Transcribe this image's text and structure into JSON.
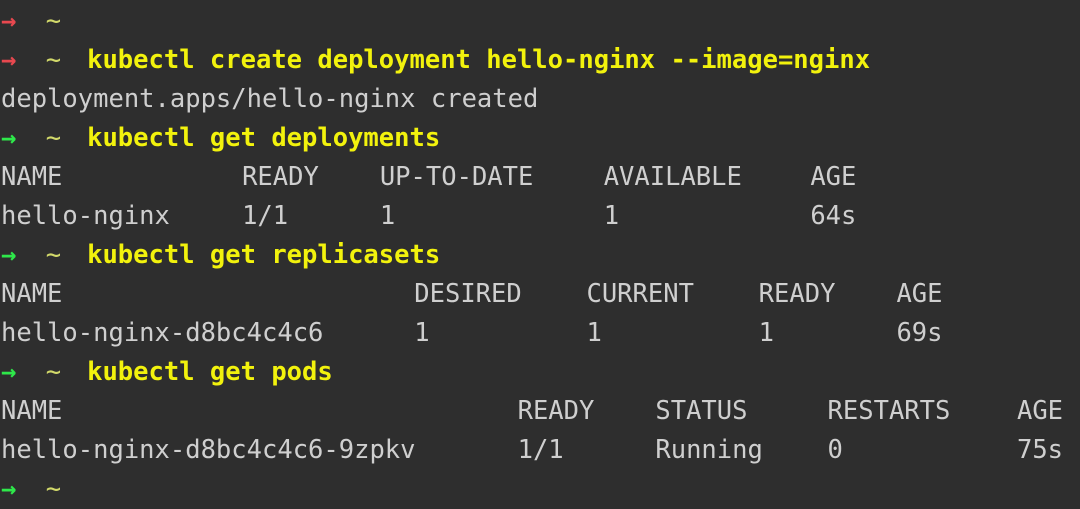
{
  "terminal": {
    "background_color": "#2e2e2e",
    "prompt_symbol": "→",
    "cwd_symbol": "~",
    "colors": {
      "prompt_error": "#e8484f",
      "prompt_ok": "#2ee84a",
      "cwd": "#d2d96a",
      "command": "#f2f20d",
      "output": "#cfcfcf"
    },
    "lines": [
      {
        "kind": "prompt",
        "prompt_color": "prompt_error",
        "arrow": "→",
        "cwd": "~",
        "command": ""
      },
      {
        "kind": "prompt",
        "prompt_color": "prompt_error",
        "arrow": "→",
        "cwd": "~",
        "command": "kubectl create deployment hello-nginx --image=nginx"
      },
      {
        "kind": "output",
        "text": "deployment.apps/hello-nginx created"
      },
      {
        "kind": "prompt",
        "prompt_color": "prompt_ok",
        "arrow": "→",
        "cwd": "~",
        "command": "kubectl get deployments"
      },
      {
        "kind": "table-header",
        "table": "deployments",
        "cells": [
          {
            "text": "NAME",
            "col": 0
          },
          {
            "text": "READY",
            "col": 14
          },
          {
            "text": "UP-TO-DATE",
            "col": 22
          },
          {
            "text": "AVAILABLE",
            "col": 35
          },
          {
            "text": "AGE",
            "col": 47
          }
        ]
      },
      {
        "kind": "table-row",
        "table": "deployments",
        "cells": [
          {
            "text": "hello-nginx",
            "col": 0
          },
          {
            "text": "1/1",
            "col": 14
          },
          {
            "text": "1",
            "col": 22
          },
          {
            "text": "1",
            "col": 35
          },
          {
            "text": "64s",
            "col": 47
          }
        ]
      },
      {
        "kind": "prompt",
        "prompt_color": "prompt_ok",
        "arrow": "→",
        "cwd": "~",
        "command": "kubectl get replicasets"
      },
      {
        "kind": "table-header",
        "table": "replicasets",
        "cells": [
          {
            "text": "NAME",
            "col": 0
          },
          {
            "text": "DESIRED",
            "col": 24
          },
          {
            "text": "CURRENT",
            "col": 34
          },
          {
            "text": "READY",
            "col": 44
          },
          {
            "text": "AGE",
            "col": 52
          }
        ]
      },
      {
        "kind": "table-row",
        "table": "replicasets",
        "cells": [
          {
            "text": "hello-nginx-d8bc4c4c6",
            "col": 0
          },
          {
            "text": "1",
            "col": 24
          },
          {
            "text": "1",
            "col": 34
          },
          {
            "text": "1",
            "col": 44
          },
          {
            "text": "69s",
            "col": 52
          }
        ]
      },
      {
        "kind": "prompt",
        "prompt_color": "prompt_ok",
        "arrow": "→",
        "cwd": "~",
        "command": "kubectl get pods"
      },
      {
        "kind": "table-header",
        "table": "pods",
        "cells": [
          {
            "text": "NAME",
            "col": 0
          },
          {
            "text": "READY",
            "col": 30
          },
          {
            "text": "STATUS",
            "col": 38
          },
          {
            "text": "RESTARTS",
            "col": 48
          },
          {
            "text": "AGE",
            "col": 59
          }
        ]
      },
      {
        "kind": "table-row",
        "table": "pods",
        "cells": [
          {
            "text": "hello-nginx-d8bc4c4c6-9zpkv",
            "col": 0
          },
          {
            "text": "1/1",
            "col": 30
          },
          {
            "text": "Running",
            "col": 38
          },
          {
            "text": "0",
            "col": 48
          },
          {
            "text": "75s",
            "col": 59
          }
        ]
      },
      {
        "kind": "prompt",
        "prompt_color": "prompt_ok",
        "arrow": "→",
        "cwd": "~",
        "command": ""
      }
    ]
  }
}
